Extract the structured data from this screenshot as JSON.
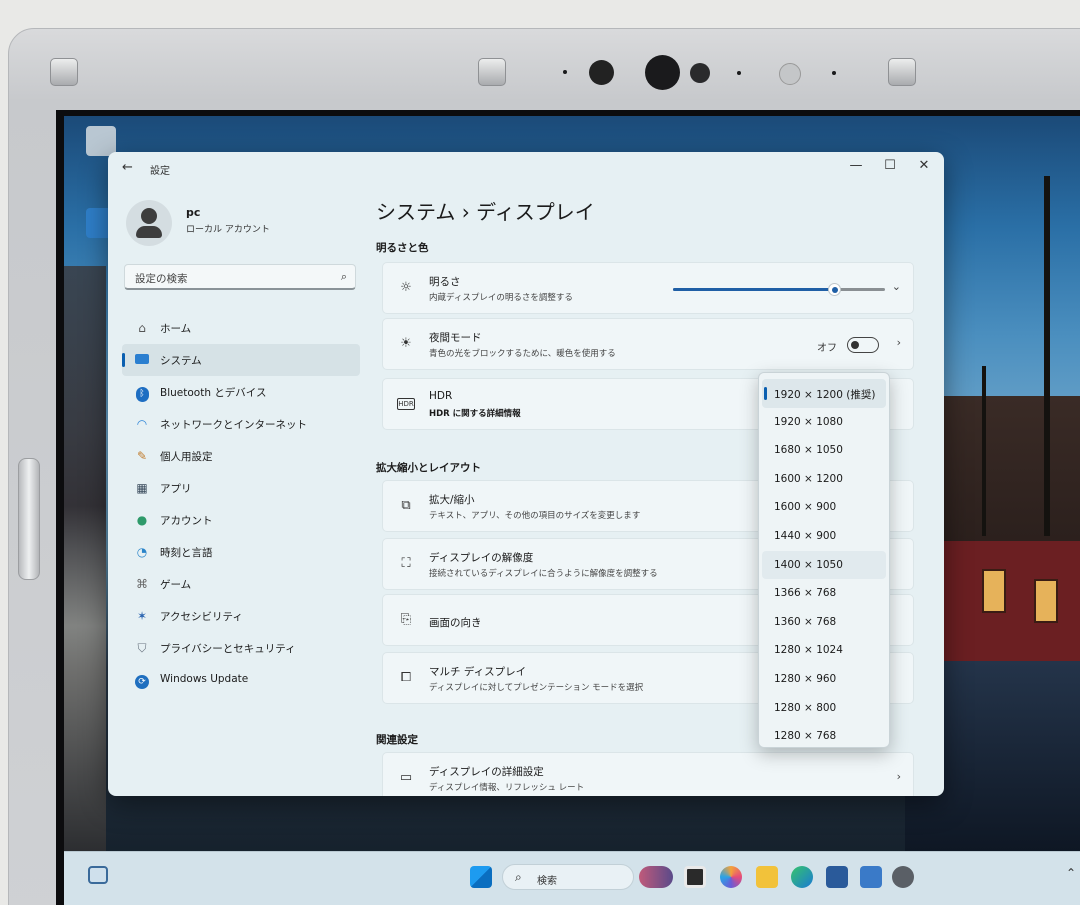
{
  "window": {
    "title": "設定",
    "back_glyph": "←",
    "minimize_glyph": "—",
    "maximize_glyph": "☐",
    "close_glyph": "✕"
  },
  "profile": {
    "name": "pc",
    "account": "ローカル アカウント"
  },
  "search": {
    "placeholder": "設定の検索"
  },
  "nav": {
    "items": [
      {
        "label": "ホーム",
        "icon": "home-icon"
      },
      {
        "label": "システム",
        "icon": "monitor-icon",
        "active": true
      },
      {
        "label": "Bluetooth とデバイス",
        "icon": "bluetooth-icon"
      },
      {
        "label": "ネットワークとインターネット",
        "icon": "wifi-icon"
      },
      {
        "label": "個人用設定",
        "icon": "brush-icon"
      },
      {
        "label": "アプリ",
        "icon": "apps-icon"
      },
      {
        "label": "アカウント",
        "icon": "person-icon"
      },
      {
        "label": "時刻と言語",
        "icon": "globe-clock-icon"
      },
      {
        "label": "ゲーム",
        "icon": "gamepad-icon"
      },
      {
        "label": "アクセシビリティ",
        "icon": "accessibility-icon"
      },
      {
        "label": "プライバシーとセキュリティ",
        "icon": "shield-icon"
      },
      {
        "label": "Windows Update",
        "icon": "update-icon"
      }
    ]
  },
  "main": {
    "breadcrumb": "システム  ›  ディスプレイ",
    "section_brightness": "明るさと色",
    "section_scale": "拡大縮小とレイアウト",
    "section_related": "関連設定",
    "brightness": {
      "title": "明るさ",
      "subtitle": "内蔵ディスプレイの明るさを調整する",
      "level_percent": 76
    },
    "night": {
      "title": "夜間モード",
      "subtitle": "青色の光をブロックするために、暖色を使用する",
      "state": "オフ"
    },
    "hdr": {
      "title": "HDR",
      "subtitle": "HDR に関する詳細情報",
      "icon_text": "HDR"
    },
    "scale": {
      "title": "拡大/縮小",
      "subtitle": "テキスト、アプリ、その他の項目のサイズを変更します"
    },
    "resolution": {
      "title": "ディスプレイの解像度",
      "subtitle": "接続されているディスプレイに合うように解像度を調整する"
    },
    "orientation": {
      "title": "画面の向き"
    },
    "multi": {
      "title": "マルチ ディスプレイ",
      "subtitle": "ディスプレイに対してプレゼンテーション モードを選択"
    },
    "advanced": {
      "title": "ディスプレイの詳細設定",
      "subtitle": "ディスプレイ情報、リフレッシュ レート"
    }
  },
  "resolution_options": [
    "1920 × 1200 (推奨)",
    "1920 × 1080",
    "1680 × 1050",
    "1600 × 1200",
    "1600 × 900",
    "1440 × 900",
    "1400 × 1050",
    "1366 × 768",
    "1360 × 768",
    "1280 × 1024",
    "1280 × 960",
    "1280 × 800",
    "1280 × 768"
  ],
  "taskbar": {
    "search_label": "検索"
  },
  "colors": {
    "accent": "#0a5fb0",
    "window_bg": "#e6f0f3",
    "card_bg": "#f0f6f8"
  }
}
